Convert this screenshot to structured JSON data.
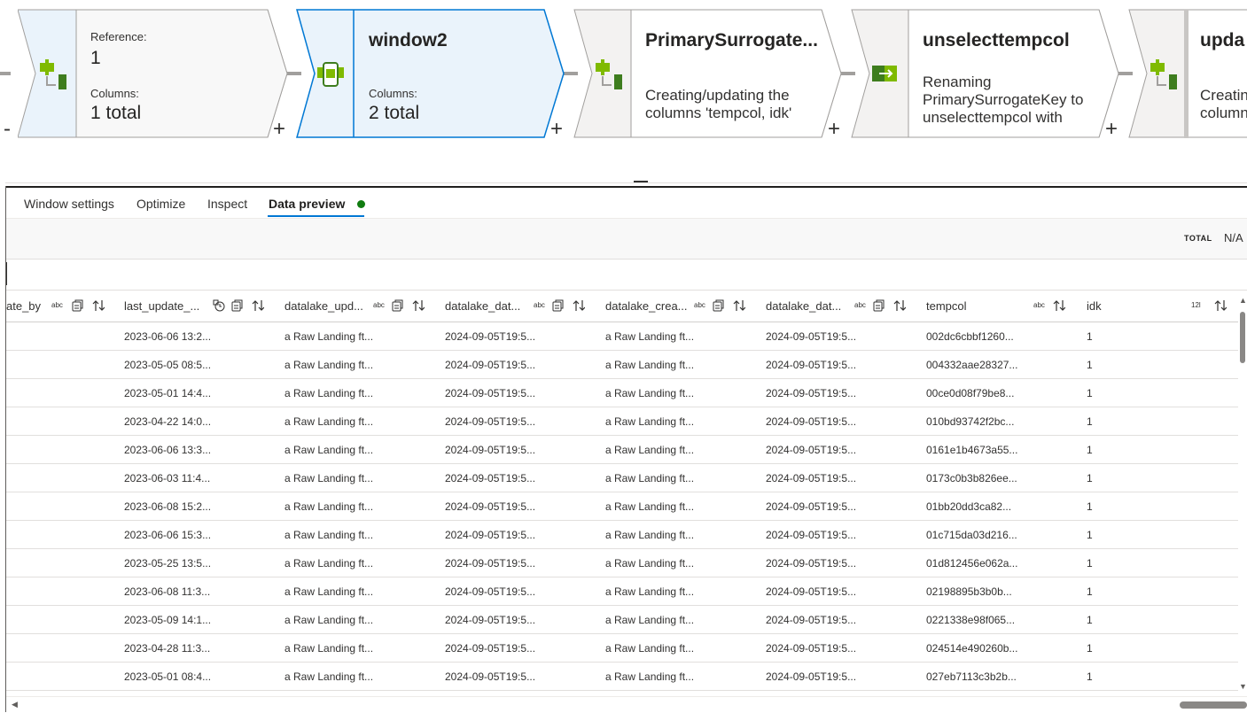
{
  "pipeline": {
    "nodes": [
      {
        "title": "",
        "label1": "Reference:",
        "value1": "1",
        "label2": "Columns:",
        "value2": "1 total"
      },
      {
        "title": "window2",
        "label2": "Columns:",
        "value2": "2 total"
      },
      {
        "title": "PrimarySurrogate...",
        "desc": "Creating/updating the columns 'tempcol, idk'"
      },
      {
        "title": "unselecttempcol",
        "desc": "Renaming PrimarySurrogateKey to unselecttempcol with column with..."
      },
      {
        "title": "upda",
        "desc": "Creatin columns"
      }
    ],
    "add_symbol": "+",
    "left_symbol": "-"
  },
  "tabs": [
    "Window settings",
    "Optimize",
    "Inspect",
    "Data preview"
  ],
  "summary": {
    "total_label": "TOTAL",
    "total_value": "N/A"
  },
  "grid": {
    "columns": [
      {
        "name": "ate_by",
        "type": "abc"
      },
      {
        "name": "last_update_...",
        "type": ""
      },
      {
        "name": "datalake_upd...",
        "type": "abc"
      },
      {
        "name": "datalake_dat...",
        "type": "abc"
      },
      {
        "name": "datalake_crea...",
        "type": "abc"
      },
      {
        "name": "datalake_dat...",
        "type": "abc"
      },
      {
        "name": "tempcol",
        "type": "abc"
      },
      {
        "name": "idk",
        "type": "12l"
      }
    ],
    "rows": [
      [
        "",
        "2023-06-06 13:2...",
        "a Raw Landing ft...",
        "2024-09-05T19:5...",
        "a Raw Landing ft...",
        "2024-09-05T19:5...",
        "002dc6cbbf1260...",
        "1"
      ],
      [
        "",
        "2023-05-05 08:5...",
        "a Raw Landing ft...",
        "2024-09-05T19:5...",
        "a Raw Landing ft...",
        "2024-09-05T19:5...",
        "004332aae28327...",
        "1"
      ],
      [
        "",
        "2023-05-01 14:4...",
        "a Raw Landing ft...",
        "2024-09-05T19:5...",
        "a Raw Landing ft...",
        "2024-09-05T19:5...",
        "00ce0d08f79be8...",
        "1"
      ],
      [
        "",
        "2023-04-22 14:0...",
        "a Raw Landing ft...",
        "2024-09-05T19:5...",
        "a Raw Landing ft...",
        "2024-09-05T19:5...",
        "010bd93742f2bc...",
        "1"
      ],
      [
        "",
        "2023-06-06 13:3...",
        "a Raw Landing ft...",
        "2024-09-05T19:5...",
        "a Raw Landing ft...",
        "2024-09-05T19:5...",
        "0161e1b4673a55...",
        "1"
      ],
      [
        "",
        "2023-06-03 11:4...",
        "a Raw Landing ft...",
        "2024-09-05T19:5...",
        "a Raw Landing ft...",
        "2024-09-05T19:5...",
        "0173c0b3b826ee...",
        "1"
      ],
      [
        "",
        "2023-06-08 15:2...",
        "a Raw Landing ft...",
        "2024-09-05T19:5...",
        "a Raw Landing ft...",
        "2024-09-05T19:5...",
        "01bb20dd3ca82...",
        "1"
      ],
      [
        "",
        "2023-06-06 15:3...",
        "a Raw Landing ft...",
        "2024-09-05T19:5...",
        "a Raw Landing ft...",
        "2024-09-05T19:5...",
        "01c715da03d216...",
        "1"
      ],
      [
        "",
        "2023-05-25 13:5...",
        "a Raw Landing ft...",
        "2024-09-05T19:5...",
        "a Raw Landing ft...",
        "2024-09-05T19:5...",
        "01d812456e062a...",
        "1"
      ],
      [
        "",
        "2023-06-08 11:3...",
        "a Raw Landing ft...",
        "2024-09-05T19:5...",
        "a Raw Landing ft...",
        "2024-09-05T19:5...",
        "02198895b3b0b...",
        "1"
      ],
      [
        "",
        "2023-05-09 14:1...",
        "a Raw Landing ft...",
        "2024-09-05T19:5...",
        "a Raw Landing ft...",
        "2024-09-05T19:5...",
        "0221338e98f065...",
        "1"
      ],
      [
        "",
        "2023-04-28 11:3...",
        "a Raw Landing ft...",
        "2024-09-05T19:5...",
        "a Raw Landing ft...",
        "2024-09-05T19:5...",
        "024514e490260b...",
        "1"
      ],
      [
        "",
        "2023-05-01 08:4...",
        "a Raw Landing ft...",
        "2024-09-05T19:5...",
        "a Raw Landing ft...",
        "2024-09-05T19:5...",
        "027eb7113c3b2b...",
        "1"
      ]
    ]
  },
  "colors": {
    "accent": "#0078d4",
    "status": "#107c10",
    "icon_green": "#7fba00",
    "icon_dark": "#3e7d1e"
  }
}
